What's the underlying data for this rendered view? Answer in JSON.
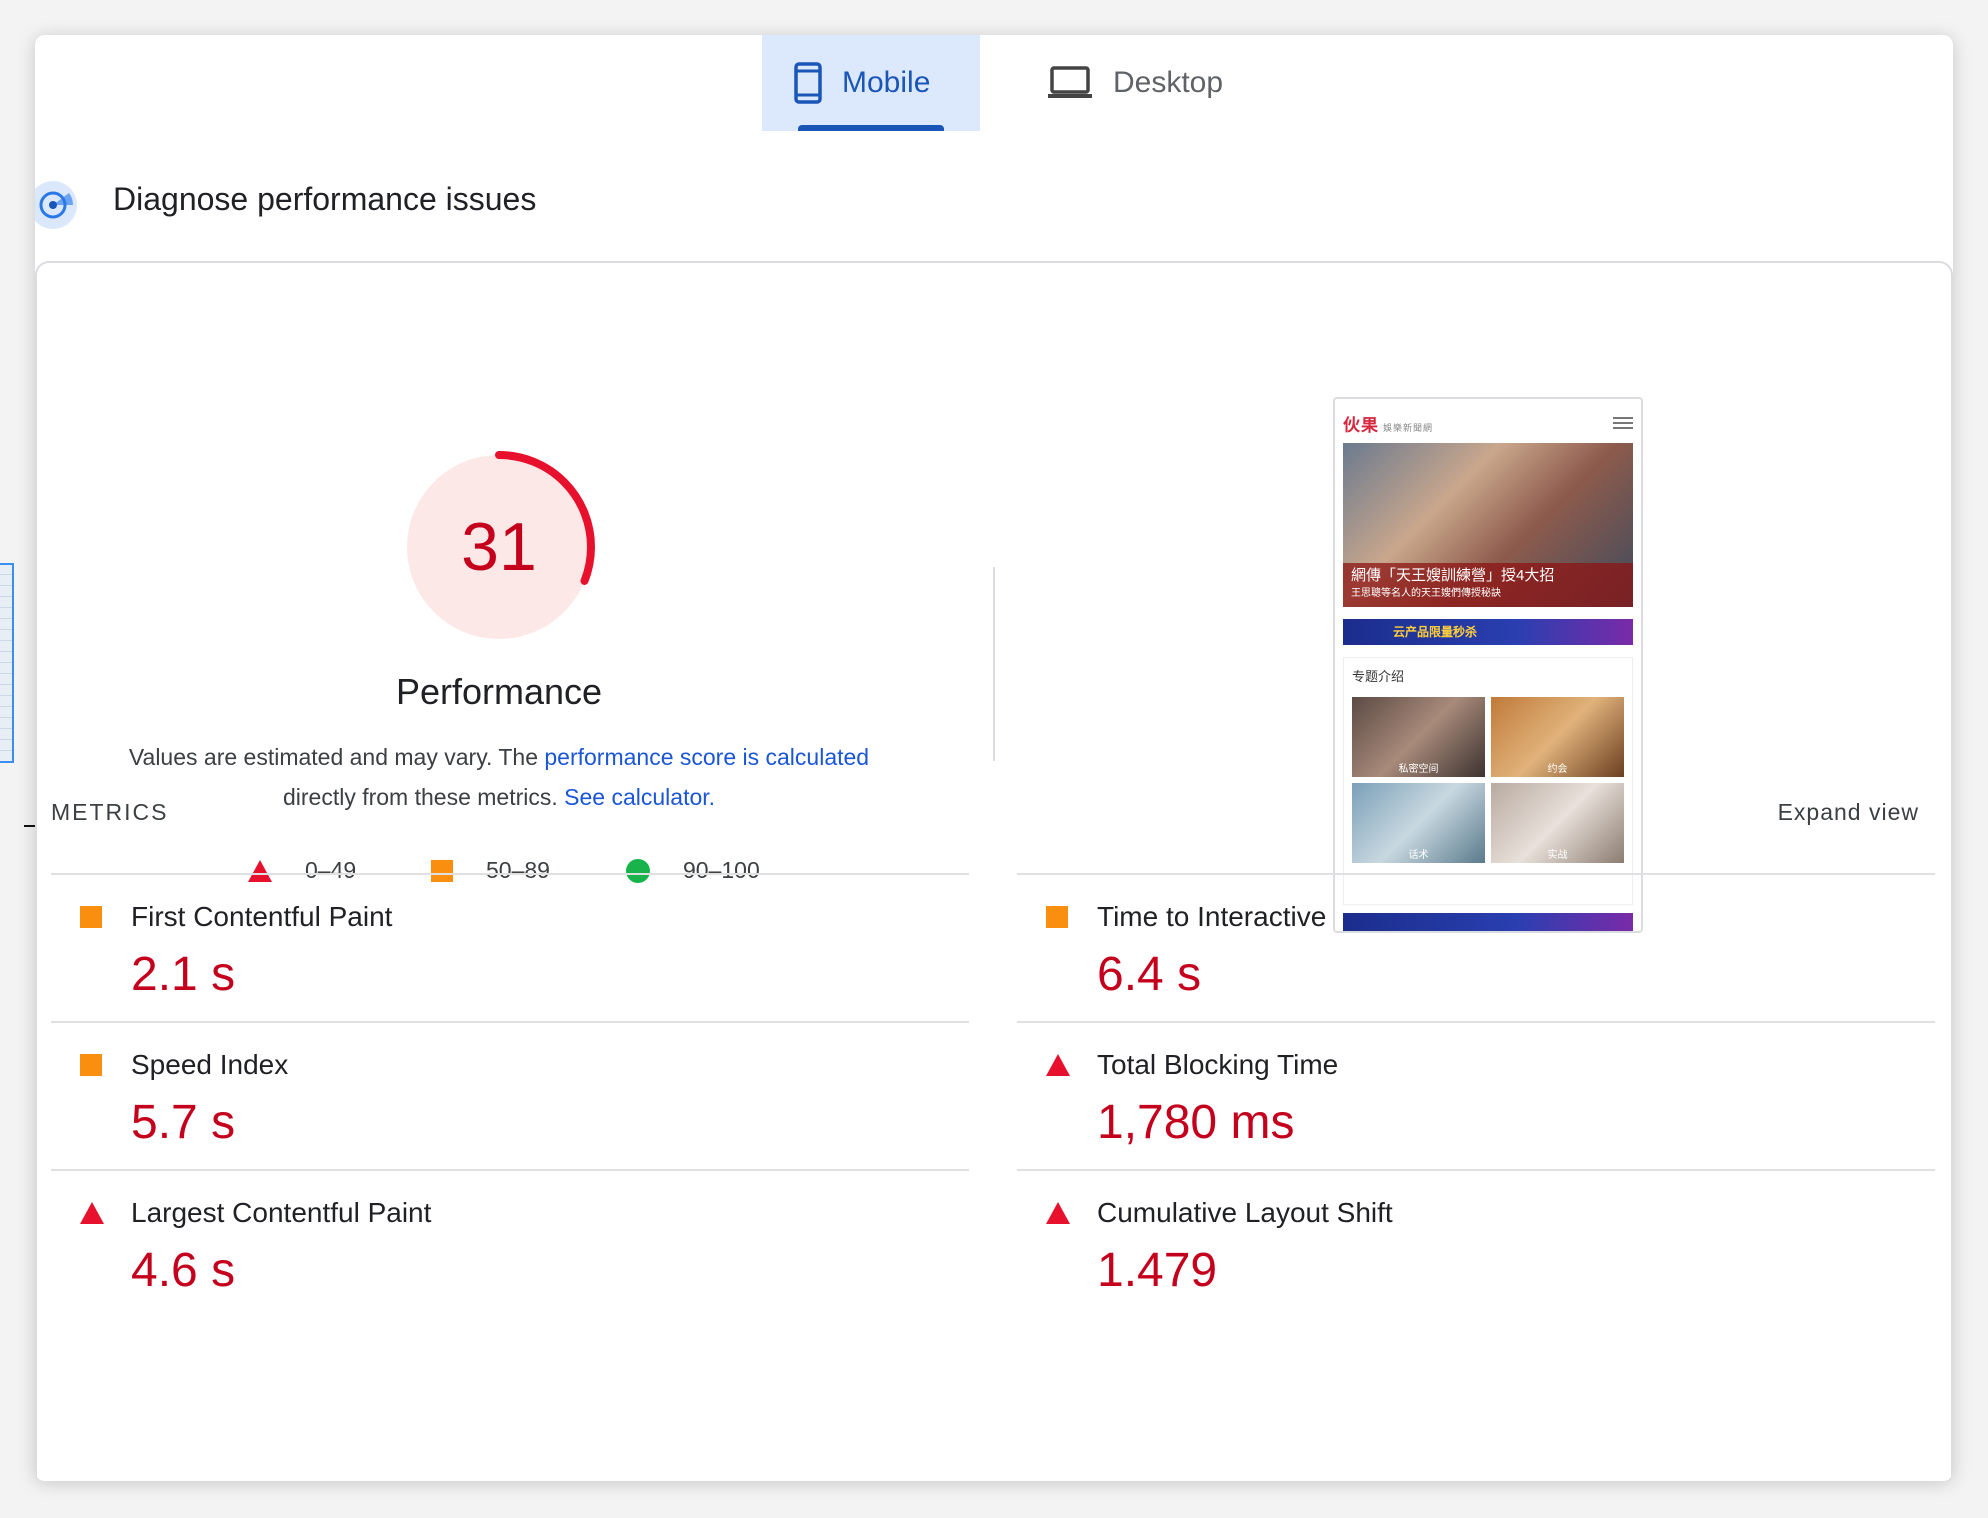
{
  "tabs": {
    "mobile": {
      "label": "Mobile",
      "active": true
    },
    "desktop": {
      "label": "Desktop",
      "active": false
    }
  },
  "header": {
    "title": "Diagnose performance issues"
  },
  "performance": {
    "score": "31",
    "score_value": 31,
    "title": "Performance",
    "desc_prefix": "Values are estimated and may vary. The ",
    "desc_link": "performance score is calculated",
    "desc_middle": "directly from these metrics. ",
    "calc_link": "See calculator.",
    "colors": {
      "fail": "#e8112d",
      "average": "#fa8e0f",
      "pass": "#18b44b",
      "fail_bg": "#fde8e8"
    }
  },
  "legend": [
    {
      "icon": "red-triangle-icon",
      "range": "0–49"
    },
    {
      "icon": "orange-square-icon",
      "range": "50–89"
    },
    {
      "icon": "green-circle-icon",
      "range": "90–100"
    }
  ],
  "screenshot": {
    "logo": "伙果",
    "logo_sub": "娛樂新聞網",
    "hero_caption": "網傳「天王嫂訓練營」授4大招",
    "hero_sub": "王思聰等名人的天王嫂們傳授秘訣",
    "banner": "云产品限量秒杀",
    "section_title": "专题介绍",
    "cells": [
      "私密空间",
      "约会",
      "话术",
      "实战"
    ]
  },
  "metrics": {
    "label": "METRICS",
    "expand": "Expand view",
    "items": [
      {
        "name": "First Contentful Paint",
        "value": "2.1 s",
        "status": "average"
      },
      {
        "name": "Time to Interactive",
        "value": "6.4 s",
        "status": "average"
      },
      {
        "name": "Speed Index",
        "value": "5.7 s",
        "status": "average"
      },
      {
        "name": "Total Blocking Time",
        "value": "1,780 ms",
        "status": "fail"
      },
      {
        "name": "Largest Contentful Paint",
        "value": "4.6 s",
        "status": "fail"
      },
      {
        "name": "Cumulative Layout Shift",
        "value": "1.479",
        "status": "fail"
      }
    ]
  }
}
